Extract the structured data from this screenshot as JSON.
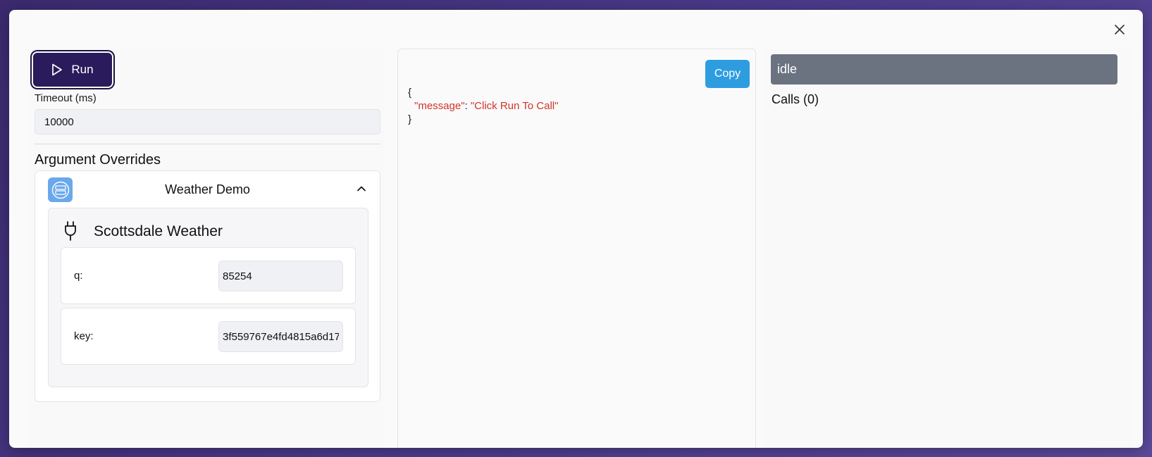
{
  "modal": {
    "close_icon": "close-icon"
  },
  "left": {
    "run_label": "Run",
    "timeout_label": "Timeout (ms)",
    "timeout_value": "10000",
    "overrides_title": "Argument Overrides",
    "app": {
      "name": "Weather Demo",
      "icon": "database-icon",
      "tool": {
        "name": "Scottsdale Weather",
        "icon": "plug-icon",
        "params": [
          {
            "label": "q:",
            "value": "85254"
          },
          {
            "label": "key:",
            "value": "3f559767e4fd4815a6d17"
          }
        ]
      }
    }
  },
  "middle": {
    "copy_label": "Copy",
    "json": {
      "open": "{",
      "key": "\"message\"",
      "colon": ": ",
      "value": "\"Click Run To Call\"",
      "close": "}"
    }
  },
  "right": {
    "status": "idle",
    "calls_label": "Calls (0)"
  },
  "colors": {
    "run_button": "#2a1b5c",
    "copy_button": "#2d9de0",
    "status_bar": "#6b7280",
    "json_string": "#d0342c"
  }
}
